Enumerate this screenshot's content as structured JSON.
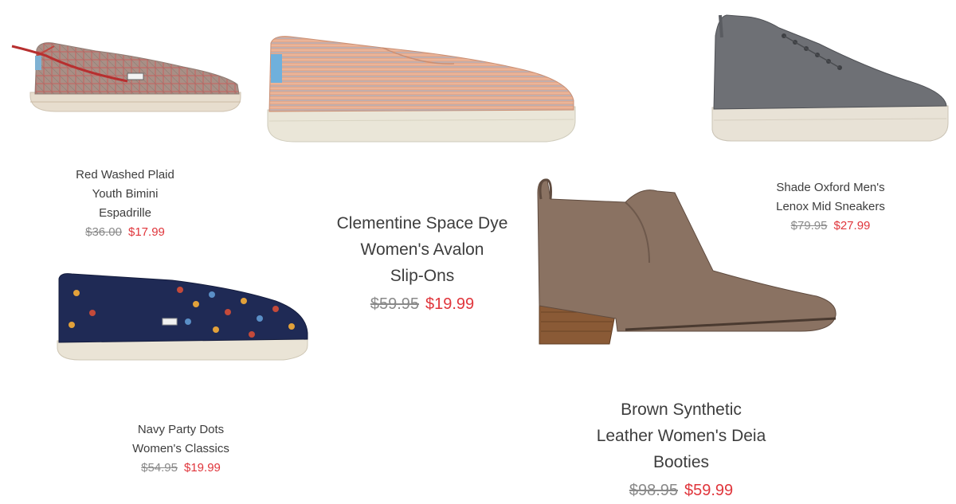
{
  "products": [
    {
      "name_lines": [
        "Red Washed Plaid",
        "Youth Bimini",
        "Espadrille"
      ],
      "old_price": "$36.00",
      "sale_price": "$17.99",
      "image": "red-plaid-espadrille-icon"
    },
    {
      "name_lines": [
        "Clementine Space Dye",
        "Women's Avalon",
        "Slip-Ons"
      ],
      "old_price": "$59.95",
      "sale_price": "$19.99",
      "image": "clementine-slip-on-icon"
    },
    {
      "name_lines": [
        "Shade Oxford Men's",
        "Lenox Mid Sneakers"
      ],
      "old_price": "$79.95",
      "sale_price": "$27.99",
      "image": "gray-mid-sneaker-icon"
    },
    {
      "name_lines": [
        "Navy Party Dots",
        "Women's Classics"
      ],
      "old_price": "$54.95",
      "sale_price": "$19.99",
      "image": "navy-dots-classic-icon"
    },
    {
      "name_lines": [
        "Brown Synthetic",
        "Leather Women's Deia",
        "Booties"
      ],
      "old_price": "$98.95",
      "sale_price": "$59.99",
      "image": "brown-bootie-icon"
    }
  ],
  "colors": {
    "sale_price": "#e0363c",
    "old_price": "#8a8a8a",
    "text": "#3d3d3d"
  }
}
